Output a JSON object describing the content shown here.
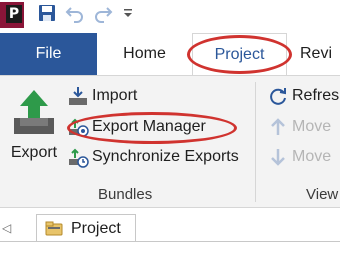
{
  "quick_access": {
    "app_logo_letter": "P",
    "icons": [
      "save-icon",
      "undo-icon",
      "redo-icon",
      "customize-dropdown-icon"
    ]
  },
  "tabs": [
    {
      "label": "File"
    },
    {
      "label": "Home"
    },
    {
      "label": "Project"
    },
    {
      "label": "Revi"
    }
  ],
  "ribbon": {
    "bundles": {
      "export_label": "Export",
      "import_label": "Import",
      "export_manager_label": "Export Manager",
      "synchronize_exports_label": "Synchronize Exports",
      "group_label": "Bundles"
    },
    "view": {
      "refresh_label": "Refresh",
      "move_up_label": "Move",
      "move_down_label": "Move",
      "group_label": "View"
    }
  },
  "document_tabs": [
    {
      "label": "Project"
    }
  ],
  "colors": {
    "accent": "#2b579a",
    "annotation": "#d0332f",
    "export_green": "#2e9a4a",
    "disabled": "#b5b5b5"
  }
}
